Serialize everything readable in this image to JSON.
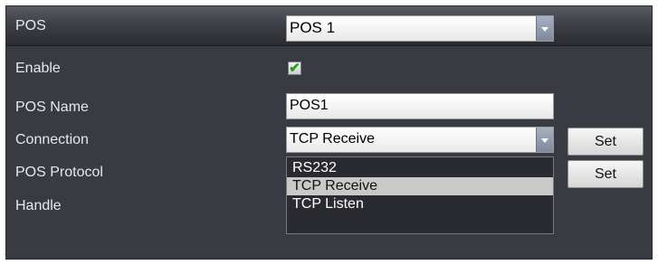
{
  "header": {
    "title": "POS",
    "pos_select_value": "POS 1"
  },
  "fields": {
    "enable_label": "Enable",
    "enable_checked": true,
    "pos_name_label": "POS Name",
    "pos_name_value": "POS1",
    "connection_label": "Connection",
    "connection_value": "TCP Receive",
    "pos_protocol_label": "POS Protocol",
    "handle_label": "Handle"
  },
  "buttons": {
    "set_connection_label": "Set",
    "set_protocol_label": "Set"
  },
  "connection_dropdown": {
    "options": [
      "RS232",
      "TCP Receive",
      "TCP Listen"
    ],
    "selected": "TCP Receive"
  },
  "icons": {
    "checkmark": "check-icon",
    "dropdown_arrow": "chevron-down-icon"
  },
  "colors": {
    "panel_bg": "#393b42",
    "check_color": "#2e9b1e",
    "dropdown_bg": "#2a2b30",
    "selected_option_bg": "#c9c9c9"
  }
}
